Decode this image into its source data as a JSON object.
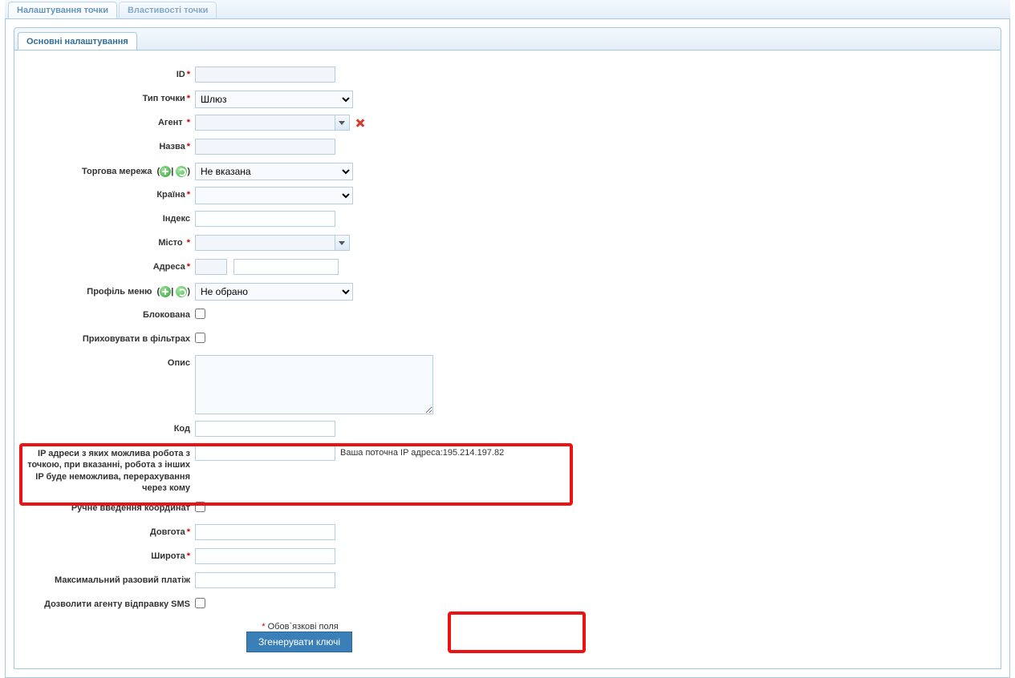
{
  "topTabs": {
    "settings": "Налаштування точки",
    "props": "Властивості точки"
  },
  "innerTab": "Основні налаштування",
  "labels": {
    "id": "ID",
    "pointType": "Тип точки",
    "agent": "Агент",
    "name": "Назва",
    "tradeNetwork": "Торгова мережа",
    "country": "Країна",
    "index": "Індекс",
    "city": "Місто",
    "address": "Адреса",
    "menuProfile": "Профіль меню",
    "blocked": "Блокована",
    "hideInFilters": "Приховувати в фільтрах",
    "description": "Опис",
    "code": "Код",
    "ipAddresses": "IP адреси з яких можлива робота з точкою, при вказанні, робота з інших IP буде неможлива, перерахування через кому",
    "manualCoords": "Ручне введення координат",
    "longitude": "Довгота",
    "latitude": "Широта",
    "maxSinglePayment": "Максимальний разовий платіж",
    "allowAgentSms": "Дозволити агенту відправку SMS"
  },
  "values": {
    "id": "",
    "pointType": "Шлюз",
    "agent": "",
    "name": "",
    "tradeNetwork": "Не вказана",
    "country": "",
    "index": "",
    "city": "",
    "addressPrefix": "",
    "address": "",
    "menuProfile": "Не обрано",
    "blocked": false,
    "hideInFilters": false,
    "description": "",
    "code": "",
    "ipAddresses": "",
    "manualCoords": false,
    "longitude": "",
    "latitude": "",
    "maxSinglePayment": "",
    "allowAgentSms": false
  },
  "ipNote": "Ваша поточна IP адреса:195.214.197.82",
  "requiredNote": "Обов`язкові поля",
  "generateBtn": "Згенерувати ключі"
}
